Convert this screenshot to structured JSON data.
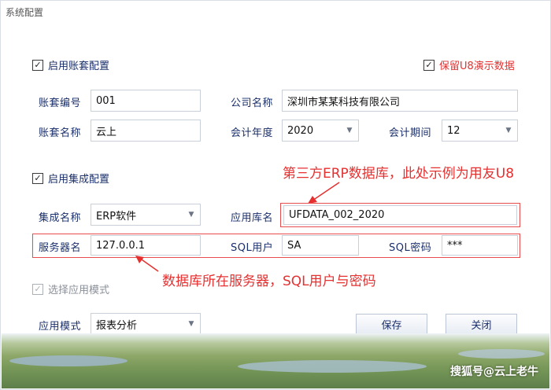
{
  "window": {
    "title": "系统配置"
  },
  "account": {
    "enable_label": "启用账套配置",
    "enable_checked": true,
    "keep_demo_label": "保留U8演示数据",
    "keep_demo_checked": true,
    "code_label": "账套编号",
    "code_value": "001",
    "company_label": "公司名称",
    "company_value": "深圳市某某科技有限公司",
    "name_label": "账套名称",
    "name_value": "云上",
    "year_label": "会计年度",
    "year_value": "2020",
    "period_label": "会计期间",
    "period_value": "12"
  },
  "integration": {
    "enable_label": "启用集成配置",
    "enable_checked": true,
    "name_label": "集成名称",
    "name_value": "ERP软件",
    "dbname_label": "应用库名",
    "dbname_value": "UFDATA_002_2020",
    "server_label": "服务器名",
    "server_value": "127.0.0.1",
    "sqluser_label": "SQL用户",
    "sqluser_value": "SA",
    "sqlpwd_label": "SQL密码",
    "sqlpwd_value": "***"
  },
  "mode": {
    "select_label": "选择应用模式",
    "select_checked": true,
    "mode_label": "应用模式",
    "mode_value": "报表分析"
  },
  "buttons": {
    "save": "保存",
    "close": "关闭"
  },
  "annotations": {
    "note_top": "第三方ERP数据库，此处示例为用友U8",
    "note_bottom": "数据库所在服务器，SQL用户与密码"
  },
  "watermark": "搜狐号@云上老牛",
  "icons": {
    "check": "✓",
    "dropdown": "▼",
    "arrow": "arrow-annotation-icon"
  },
  "colors": {
    "annotation": "#e53030",
    "label": "#1a2f6b",
    "border": "#c9d0da"
  }
}
